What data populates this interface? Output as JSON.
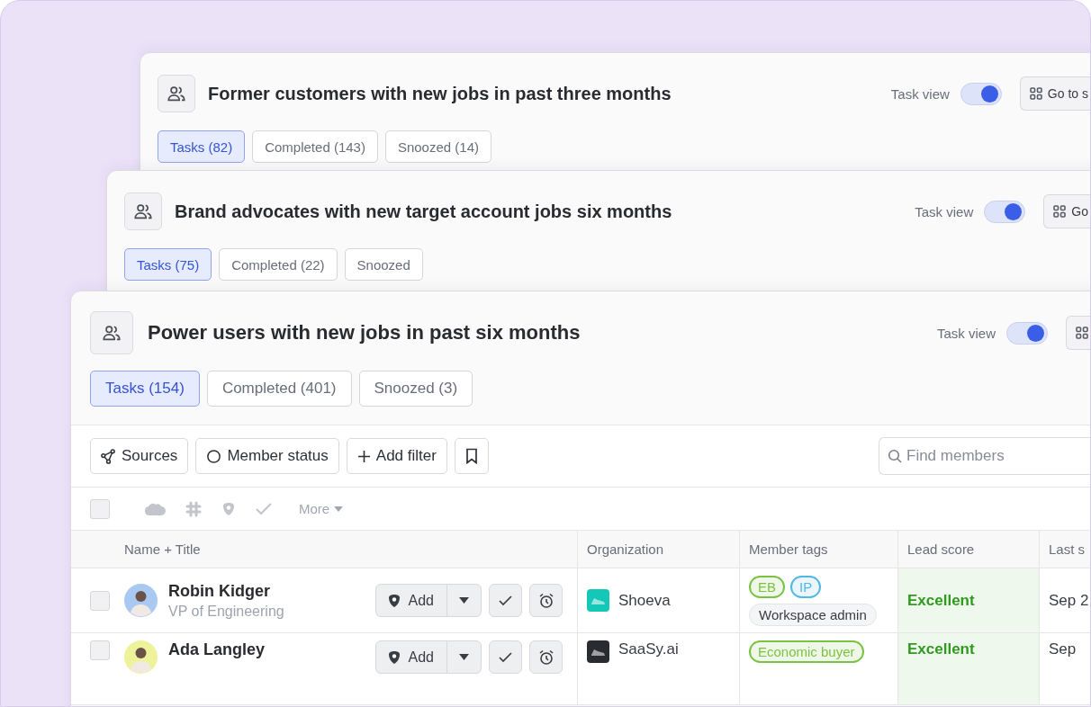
{
  "cards": [
    {
      "title": "Former customers with new jobs in past three months",
      "task_view": {
        "label": "Task view",
        "on": true
      },
      "go_button": {
        "label": "Go to s"
      },
      "tabs": [
        {
          "label": "Tasks (82)",
          "selected": true
        },
        {
          "label": "Completed (143)",
          "selected": false
        },
        {
          "label": "Snoozed (14)",
          "selected": false
        }
      ]
    },
    {
      "title": "Brand advocates with new target account jobs six months",
      "task_view": {
        "label": "Task view",
        "on": true
      },
      "go_button": {
        "label": "Go"
      },
      "tabs": [
        {
          "label": "Tasks (75)",
          "selected": true
        },
        {
          "label": "Completed (22)",
          "selected": false
        },
        {
          "label": "Snoozed",
          "selected": false
        }
      ]
    },
    {
      "title": "Power users with new jobs in past six months",
      "task_view": {
        "label": "Task view",
        "on": true
      },
      "go_button": {
        "shown": true
      },
      "tabs": [
        {
          "label": "Tasks (154)",
          "selected": true
        },
        {
          "label": "Completed (401)",
          "selected": false
        },
        {
          "label": "Snoozed (3)",
          "selected": false
        }
      ]
    }
  ],
  "filters": [
    {
      "kind": "sources",
      "label": "Sources"
    },
    {
      "kind": "status",
      "label": "Member status"
    },
    {
      "kind": "add",
      "label": "Add filter"
    },
    {
      "kind": "bookmark"
    }
  ],
  "search": {
    "placeholder": "Find members"
  },
  "bulk_bar": {
    "checked": false,
    "more": "More"
  },
  "table": {
    "columns": [
      "Name + Title",
      "Organization",
      "Member tags",
      "Lead score",
      "Last s"
    ],
    "rows": [
      {
        "checked": false,
        "avatar": {
          "color": "#a9c8f2"
        },
        "name": "Robin Kidger",
        "title": "VP of Engineering",
        "action": "Add",
        "organization": "Shoeva",
        "org_logo": {
          "color": "#14c8b8"
        },
        "tags": [
          {
            "label": "EB",
            "color": "#7cc242"
          },
          {
            "label": "IP",
            "color": "#4fb8e6"
          },
          {
            "label": "Workspace admin",
            "color": "#e3e4e6"
          }
        ],
        "lead_score": "Excellent",
        "last": "Sep 2"
      },
      {
        "checked": false,
        "avatar": {
          "color": "#eef29a"
        },
        "name": "Ada Langley",
        "action": "Add",
        "organization": "SaaSy.ai",
        "org_logo": {
          "color": "#2a2b30"
        },
        "tags": [
          {
            "label": "Economic buyer",
            "color": "#7cc242"
          }
        ],
        "lead_score": "Excellent",
        "last": "Sep"
      }
    ]
  }
}
